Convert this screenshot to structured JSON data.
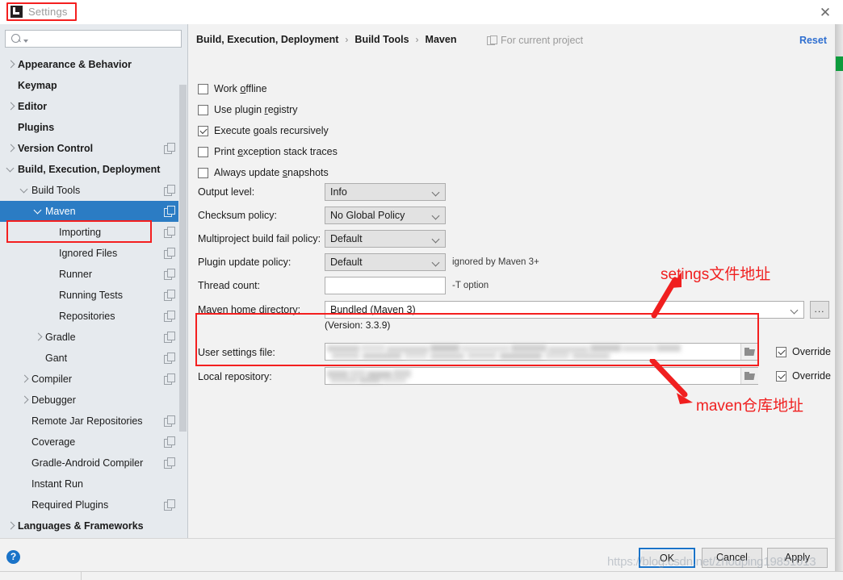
{
  "window": {
    "title": "Settings",
    "close_label": "✕",
    "app_icon": "intellij-idea-icon"
  },
  "sidebar": {
    "search": {
      "value": "",
      "placeholder": ""
    },
    "items": [
      {
        "label": "Appearance & Behavior",
        "indent": 0,
        "arrow": "right",
        "bold": true,
        "copy": false,
        "selected": false
      },
      {
        "label": "Keymap",
        "indent": 0,
        "arrow": "none",
        "bold": true,
        "copy": false,
        "selected": false
      },
      {
        "label": "Editor",
        "indent": 0,
        "arrow": "right",
        "bold": true,
        "copy": false,
        "selected": false
      },
      {
        "label": "Plugins",
        "indent": 0,
        "arrow": "none",
        "bold": true,
        "copy": false,
        "selected": false
      },
      {
        "label": "Version Control",
        "indent": 0,
        "arrow": "right",
        "bold": true,
        "copy": true,
        "selected": false
      },
      {
        "label": "Build, Execution, Deployment",
        "indent": 0,
        "arrow": "down",
        "bold": true,
        "copy": false,
        "selected": false
      },
      {
        "label": "Build Tools",
        "indent": 1,
        "arrow": "down",
        "bold": false,
        "copy": true,
        "selected": false
      },
      {
        "label": "Maven",
        "indent": 2,
        "arrow": "down",
        "bold": false,
        "copy": true,
        "selected": true
      },
      {
        "label": "Importing",
        "indent": 3,
        "arrow": "none",
        "bold": false,
        "copy": true,
        "selected": false
      },
      {
        "label": "Ignored Files",
        "indent": 3,
        "arrow": "none",
        "bold": false,
        "copy": true,
        "selected": false
      },
      {
        "label": "Runner",
        "indent": 3,
        "arrow": "none",
        "bold": false,
        "copy": true,
        "selected": false
      },
      {
        "label": "Running Tests",
        "indent": 3,
        "arrow": "none",
        "bold": false,
        "copy": true,
        "selected": false
      },
      {
        "label": "Repositories",
        "indent": 3,
        "arrow": "none",
        "bold": false,
        "copy": true,
        "selected": false
      },
      {
        "label": "Gradle",
        "indent": 2,
        "arrow": "right",
        "bold": false,
        "copy": true,
        "selected": false
      },
      {
        "label": "Gant",
        "indent": 2,
        "arrow": "none",
        "bold": false,
        "copy": true,
        "selected": false
      },
      {
        "label": "Compiler",
        "indent": 1,
        "arrow": "right",
        "bold": false,
        "copy": true,
        "selected": false
      },
      {
        "label": "Debugger",
        "indent": 1,
        "arrow": "right",
        "bold": false,
        "copy": false,
        "selected": false
      },
      {
        "label": "Remote Jar Repositories",
        "indent": 1,
        "arrow": "none",
        "bold": false,
        "copy": true,
        "selected": false
      },
      {
        "label": "Coverage",
        "indent": 1,
        "arrow": "none",
        "bold": false,
        "copy": true,
        "selected": false
      },
      {
        "label": "Gradle-Android Compiler",
        "indent": 1,
        "arrow": "none",
        "bold": false,
        "copy": true,
        "selected": false
      },
      {
        "label": "Instant Run",
        "indent": 1,
        "arrow": "none",
        "bold": false,
        "copy": false,
        "selected": false
      },
      {
        "label": "Required Plugins",
        "indent": 1,
        "arrow": "none",
        "bold": false,
        "copy": true,
        "selected": false
      },
      {
        "label": "Languages & Frameworks",
        "indent": 0,
        "arrow": "right",
        "bold": true,
        "copy": false,
        "selected": false
      }
    ]
  },
  "main": {
    "breadcrumb": [
      "Build, Execution, Deployment",
      "Build Tools",
      "Maven"
    ],
    "breadcrumb_separator": "›",
    "for_current_project": "For current project",
    "reset": "Reset",
    "checkboxes": [
      {
        "label_pre": "Work ",
        "mnemonic": "o",
        "label_post": "ffline",
        "checked": false
      },
      {
        "label_pre": "Use plugin ",
        "mnemonic": "r",
        "label_post": "egistry",
        "checked": false
      },
      {
        "label_pre": "Execute ",
        "mnemonic": "g",
        "label_post": "oals recursively",
        "checked": true
      },
      {
        "label_pre": "Print ",
        "mnemonic": "e",
        "label_post": "xception stack traces",
        "checked": false
      },
      {
        "label_pre": "Always update ",
        "mnemonic": "s",
        "label_post": "napshots",
        "checked": false
      }
    ],
    "fields": {
      "output_level": {
        "label": "Output level:",
        "value": "Info"
      },
      "checksum": {
        "label": "Checksum policy:",
        "value": "No Global Policy"
      },
      "multiproject": {
        "label": "Multiproject build fail policy:",
        "value": "Default"
      },
      "plugin_update": {
        "label": "Plugin update policy:",
        "value": "Default",
        "hint": "ignored by Maven 3+"
      },
      "thread_count": {
        "label": "Thread count:",
        "value": "",
        "hint": "-T option"
      },
      "maven_home": {
        "label": "Maven home directory:",
        "value": "Bundled (Maven 3)",
        "browse_label": "..."
      },
      "version_note": "(Version: 3.3.9)",
      "user_settings": {
        "label": "User settings file:",
        "value": "",
        "override_label": "Override",
        "override_checked": true
      },
      "local_repo": {
        "label": "Local repository:",
        "value": "",
        "override_label": "Override",
        "override_checked": true
      }
    }
  },
  "annotations": [
    {
      "text": "setings文件地址",
      "color": "#f01f1f"
    },
    {
      "text": "maven仓库地址",
      "color": "#f01f1f"
    }
  ],
  "footer": {
    "help": "?",
    "ok": "OK",
    "cancel": "Cancel",
    "apply": "Apply",
    "watermark": "https://blog.csdn.net/zhouping19851013"
  },
  "colors": {
    "selection": "#2b7cc4",
    "annotation": "#f01f1f",
    "link": "#2f6fd0",
    "primary_button_border": "#1a73c8"
  }
}
